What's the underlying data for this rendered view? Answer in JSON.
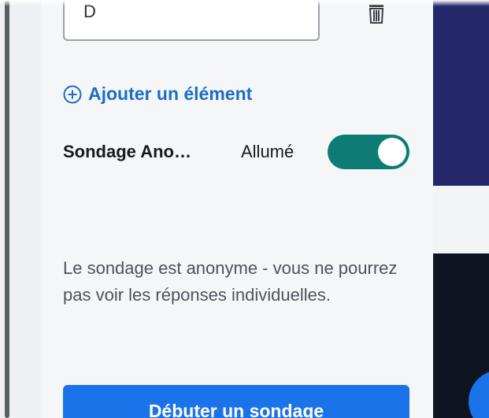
{
  "item_input": {
    "value": "D"
  },
  "add_item": {
    "label": "Ajouter un élément",
    "icon": "plus-circle-icon"
  },
  "anonymous_setting": {
    "label": "Sondage Ano…",
    "state_label": "Allumé",
    "enabled": true,
    "toggle_color": "#0c7c74"
  },
  "hint": {
    "text": "Le sondage est anonyme - vous ne pourrez pas voir les réponses individuelles."
  },
  "start_button": {
    "label": "Débuter un sondage",
    "color": "#1a73e8"
  },
  "colors": {
    "accent": "#1b6ec2",
    "background_right_top": "#24286a",
    "background_right_bottom": "#0f1422"
  }
}
